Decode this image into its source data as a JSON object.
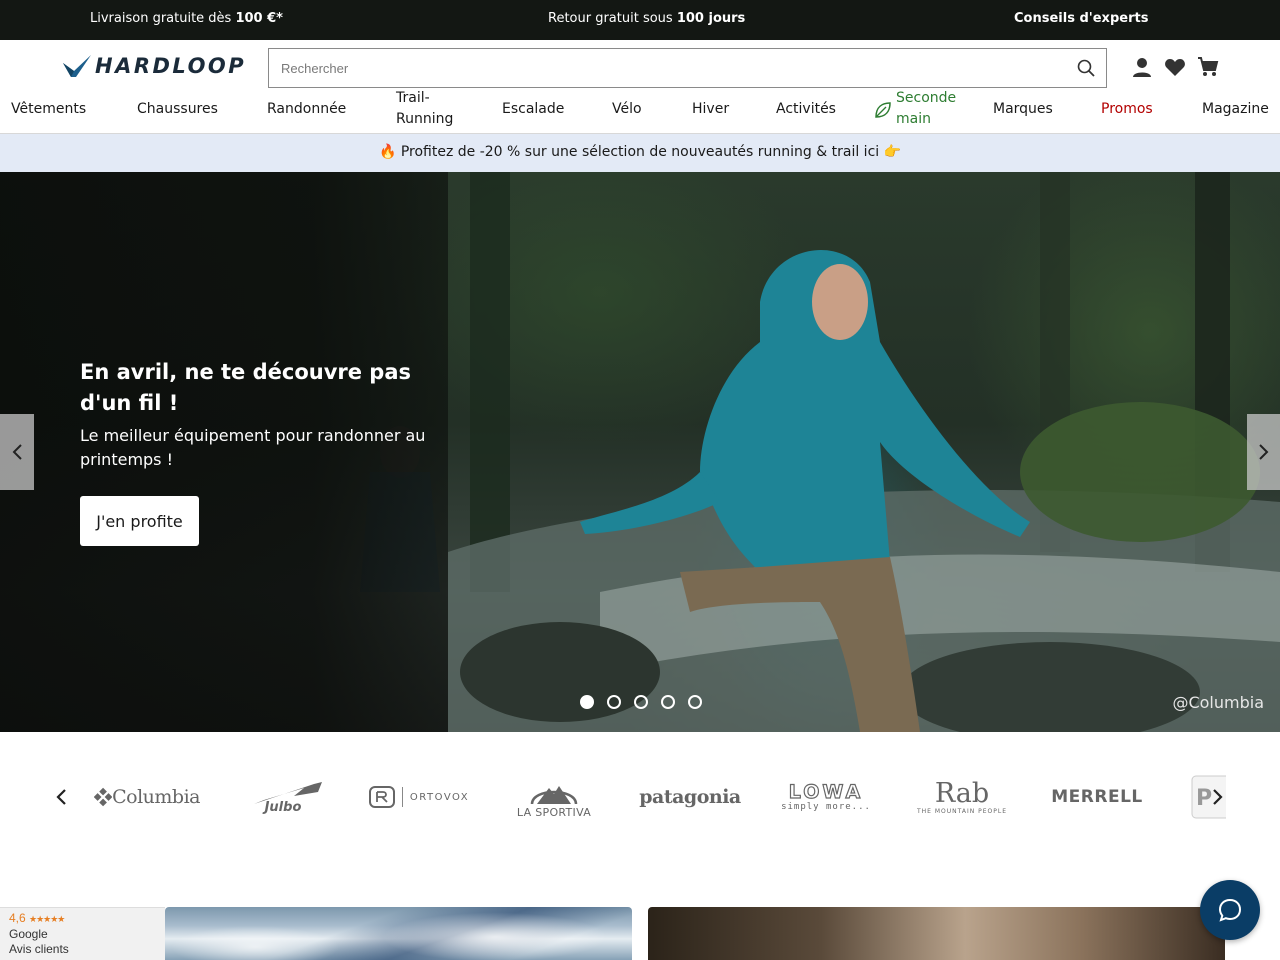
{
  "topbar": {
    "item1_text": "Livraison gratuite dès ",
    "item1_bold": "100 €*",
    "item2_text": "Retour gratuit sous ",
    "item2_bold": "100 jours",
    "item3": "Conseils d'experts"
  },
  "header": {
    "logo_text": "HARDLOOP",
    "search_placeholder": "Rechercher",
    "icons": [
      "user-icon",
      "heart-icon",
      "cart-icon"
    ]
  },
  "nav": {
    "items": [
      {
        "label": "Vêtements"
      },
      {
        "label": "Chaussures"
      },
      {
        "label": "Randonnée"
      },
      {
        "label_line1": "Trail-",
        "label_line2": "Running"
      },
      {
        "label": "Escalade"
      },
      {
        "label": "Vélo"
      },
      {
        "label": "Hiver"
      },
      {
        "label": "Activités"
      },
      {
        "label_line1": "Seconde",
        "label_line2": "main"
      },
      {
        "label": "Marques"
      },
      {
        "label": "Promos"
      },
      {
        "label": "Magazine"
      }
    ],
    "promo_color": "#b30000",
    "green_color": "#2e7d32"
  },
  "strip": {
    "text": "🔥 Profitez de -20 % sur une sélection de nouveautés running & trail ici 👉"
  },
  "hero": {
    "title": "En avril, ne te découvre pas d'un fil !",
    "subtitle": "Le meilleur équipement pour randonner au printemps !",
    "cta": "J'en profite",
    "credit": "@Columbia",
    "slides": 5,
    "active_slide": 1
  },
  "brands": {
    "items": [
      {
        "name": "Columbia"
      },
      {
        "name": "Julbo"
      },
      {
        "name": "ORTOVOX"
      },
      {
        "name": "LA SPORTIVA"
      },
      {
        "name": "patagonia"
      },
      {
        "name": "LOWA",
        "tagline": "simply more..."
      },
      {
        "name": "Rab",
        "tagline": "THE MOUNTAIN PEOPLE"
      },
      {
        "name": "MERRELL"
      }
    ]
  },
  "gbadge": {
    "rating": "4,6",
    "stars": "★★★★★",
    "line2": "Google",
    "line3": "Avis clients"
  },
  "colors": {
    "topbar_bg": "#131713",
    "strip_bg": "#e3eaf6",
    "chat_bg": "#0a3d66"
  }
}
